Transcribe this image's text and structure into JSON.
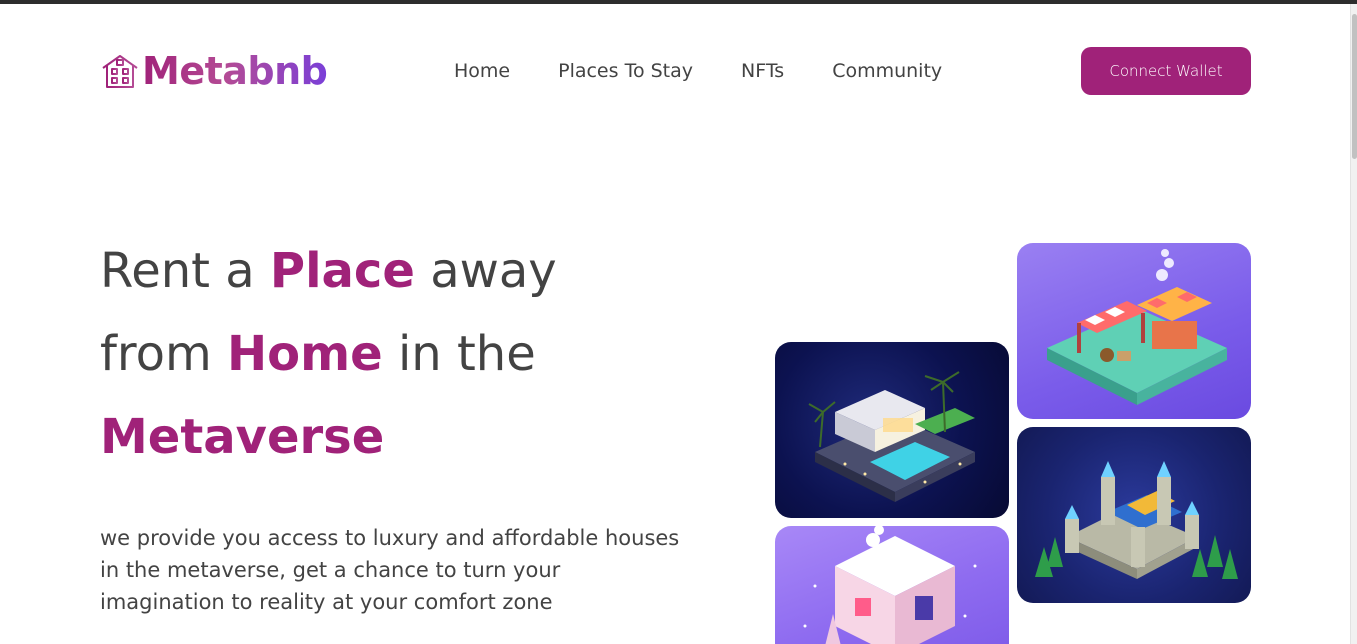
{
  "brand": {
    "name": "Metabnb",
    "icon": "house-icon"
  },
  "nav": {
    "items": [
      {
        "label": "Home"
      },
      {
        "label": "Places To Stay"
      },
      {
        "label": "NFTs"
      },
      {
        "label": "Community"
      }
    ]
  },
  "header": {
    "connect_label": "Connect Wallet"
  },
  "hero": {
    "line1_pre": "Rent a ",
    "line1_accent": "Place",
    "line1_post": " away",
    "line2_pre": "from ",
    "line2_accent": "Home",
    "line2_post": " in the",
    "line3_accent": "Metaverse",
    "description": "we provide you access to luxury and affordable houses in the metaverse, get a chance to turn your imagination to reality at your comfort zone"
  },
  "gallery": [
    {
      "name": "modern-villa-image"
    },
    {
      "name": "market-stall-image"
    },
    {
      "name": "castle-image"
    },
    {
      "name": "snow-cottage-image"
    }
  ],
  "colors": {
    "accent": "#a02279",
    "text": "#434343",
    "logo_gradient_end": "#7a3fd8"
  }
}
